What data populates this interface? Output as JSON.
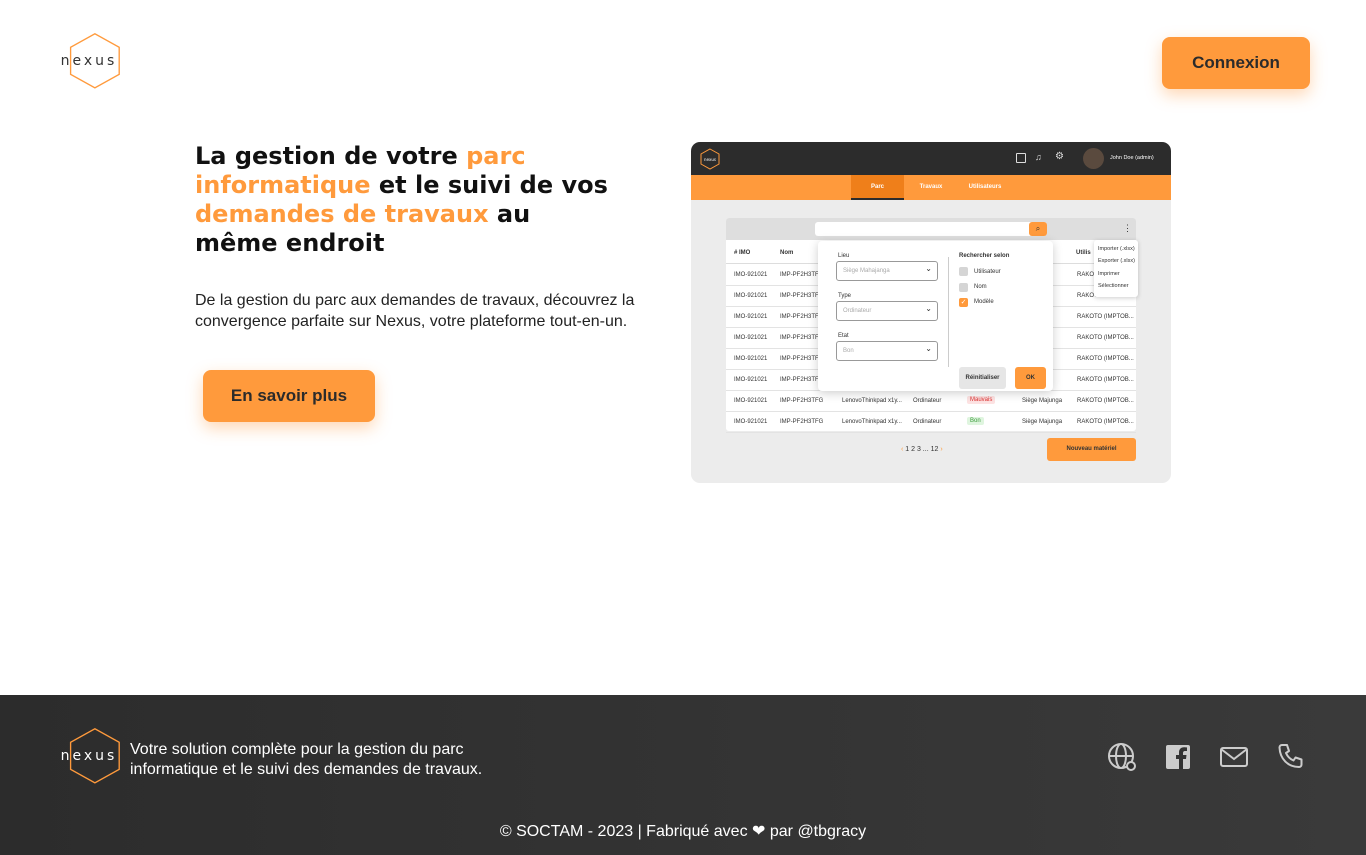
{
  "brand": {
    "name": "nexus",
    "accent": "#FF9A3C"
  },
  "header": {
    "login_label": "Connexion"
  },
  "hero": {
    "title_parts": [
      {
        "text": "La gestion de votre ",
        "highlight": false
      },
      {
        "text": "parc informatique",
        "highlight": true
      },
      {
        "text": " et le suivi de vos ",
        "highlight": false
      },
      {
        "text": "demandes de travaux",
        "highlight": true
      },
      {
        "text": " au même endroit",
        "highlight": false
      }
    ],
    "description": "De la gestion du parc aux demandes de travaux, découvrez la convergence parfaite sur Nexus, votre plateforme tout-en-un.",
    "cta_label": "En savoir plus"
  },
  "mockup": {
    "user": "John Doe (admin)",
    "tabs": [
      "Parc",
      "Travaux",
      "Utilisateurs"
    ],
    "columns": [
      "# IMO",
      "Nom",
      "Utilis"
    ],
    "rows": [
      {
        "imo": "IMO-921021",
        "nom": "IMP-PF2H3TFG",
        "desc": "",
        "type": "",
        "etat": "",
        "lieu": "",
        "user": "RAKOTO"
      },
      {
        "imo": "IMO-921021",
        "nom": "IMP-PF2H3TFG",
        "desc": "",
        "type": "",
        "etat": "",
        "lieu": "",
        "user": "RAKOTO"
      },
      {
        "imo": "IMO-921021",
        "nom": "IMP-PF2H3TFG",
        "desc": "",
        "type": "",
        "etat": "",
        "lieu": "",
        "user": "RAKOTO (IMPTOB..."
      },
      {
        "imo": "IMO-921021",
        "nom": "IMP-PF2H3TFG",
        "desc": "",
        "type": "",
        "etat": "",
        "lieu": "",
        "user": "RAKOTO (IMPTOB..."
      },
      {
        "imo": "IMO-921021",
        "nom": "IMP-PF2H3TFG",
        "desc": "",
        "type": "",
        "etat": "",
        "lieu": "",
        "user": "RAKOTO (IMPTOB..."
      },
      {
        "imo": "IMO-921021",
        "nom": "IMP-PF2H3TFG",
        "desc": "",
        "type": "",
        "etat": "",
        "lieu": "",
        "user": "RAKOTO (IMPTOB..."
      },
      {
        "imo": "IMO-921021",
        "nom": "IMP-PF2H3TFG",
        "desc": "LenovoThinkpad x1y...",
        "type": "Ordinateur",
        "etat": "Mauvais",
        "lieu": "Siège Majunga",
        "user": "RAKOTO (IMPTOB..."
      },
      {
        "imo": "IMO-921021",
        "nom": "IMP-PF2H3TFG",
        "desc": "LenovoThinkpad x1y...",
        "type": "Ordinateur",
        "etat": "Bon",
        "lieu": "Siège Majunga",
        "user": "RAKOTO (IMPTOB..."
      }
    ],
    "filter": {
      "lieu_label": "Lieu",
      "lieu_value": "Siège Mahajanga",
      "type_label": "Type",
      "type_value": "Ordinateur",
      "etat_label": "Etat",
      "etat_value": "Bon",
      "search_title": "Rechercher selon",
      "options": [
        {
          "label": "Utilisateur",
          "checked": false
        },
        {
          "label": "Nom",
          "checked": false
        },
        {
          "label": "Modèle",
          "checked": true
        }
      ],
      "reset_label": "Réinitialiser",
      "ok_label": "OK"
    },
    "menu": [
      "Importer (.xlsx)",
      "Exporter (.xlsx)",
      "Imprimer",
      "Sélectionner"
    ],
    "pagination": "1 2 3 ... 12",
    "new_button": "Nouveau matériel"
  },
  "footer": {
    "tagline": "Votre solution complète pour la gestion du parc informatique et le suivi des demandes de travaux.",
    "copyright": "© SOCTAM - 2023 | Fabriqué avec ❤ par @tbgracy",
    "icons": [
      "globe-icon",
      "facebook-icon",
      "mail-icon",
      "phone-icon"
    ]
  }
}
